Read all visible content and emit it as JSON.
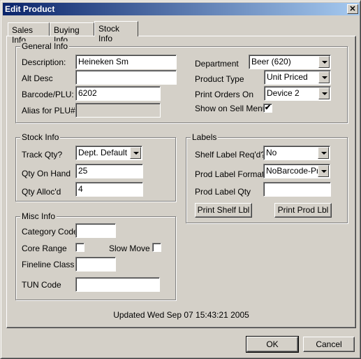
{
  "window": {
    "title": "Edit Product",
    "close_label": "✕"
  },
  "tabs": [
    {
      "label": "Sales Info",
      "active": false
    },
    {
      "label": "Buying Info",
      "active": false
    },
    {
      "label": "Stock Info",
      "active": true
    }
  ],
  "general_info": {
    "legend": "General Info",
    "description_label": "Description:",
    "description_value": "Heineken Sm",
    "alt_desc_label": "Alt Desc",
    "alt_desc_value": "",
    "barcode_label": "Barcode/PLU:",
    "barcode_value": "6202",
    "alias_label": "Alias for PLU#",
    "alias_value": "",
    "department_label": "Department",
    "department_value": "Beer (620)",
    "product_type_label": "Product Type",
    "product_type_value": "Unit Priced",
    "print_orders_label": "Print Orders On",
    "print_orders_value": "Device 2",
    "show_on_sell_menu_label": "Show on Sell Menu",
    "show_on_sell_menu_checked": true,
    "check_glyph": "✔"
  },
  "stock_info": {
    "legend": "Stock Info",
    "track_qty_label": "Track Qty?",
    "track_qty_value": "Dept. Default",
    "qty_on_hand_label": "Qty On Hand",
    "qty_on_hand_value": "25",
    "qty_allocd_label": "Qty Alloc'd",
    "qty_allocd_value": "4"
  },
  "labels": {
    "legend": "Labels",
    "shelf_label_reqd_label": "Shelf Label Req'd?",
    "shelf_label_reqd_value": "No",
    "prod_label_format_label": "Prod Label Format",
    "prod_label_format_value": "NoBarcode-Pric",
    "prod_label_qty_label": "Prod Label Qty",
    "prod_label_qty_value": "",
    "print_shelf_button": "Print Shelf Lbl",
    "print_prod_button": "Print Prod Lbl"
  },
  "misc_info": {
    "legend": "Misc Info",
    "category_code_label": "Category Code",
    "category_code_value": "",
    "core_range_label": "Core Range",
    "core_range_checked": false,
    "slow_move_label": "Slow Move",
    "slow_move_checked": false,
    "fineline_class_label": "Fineline Class",
    "fineline_class_value": "",
    "tun_code_label": "TUN Code",
    "tun_code_value": ""
  },
  "status": {
    "updated_text": "Updated Wed Sep 07 15:43:21 2005"
  },
  "footer": {
    "ok_label": "OK",
    "cancel_label": "Cancel"
  }
}
